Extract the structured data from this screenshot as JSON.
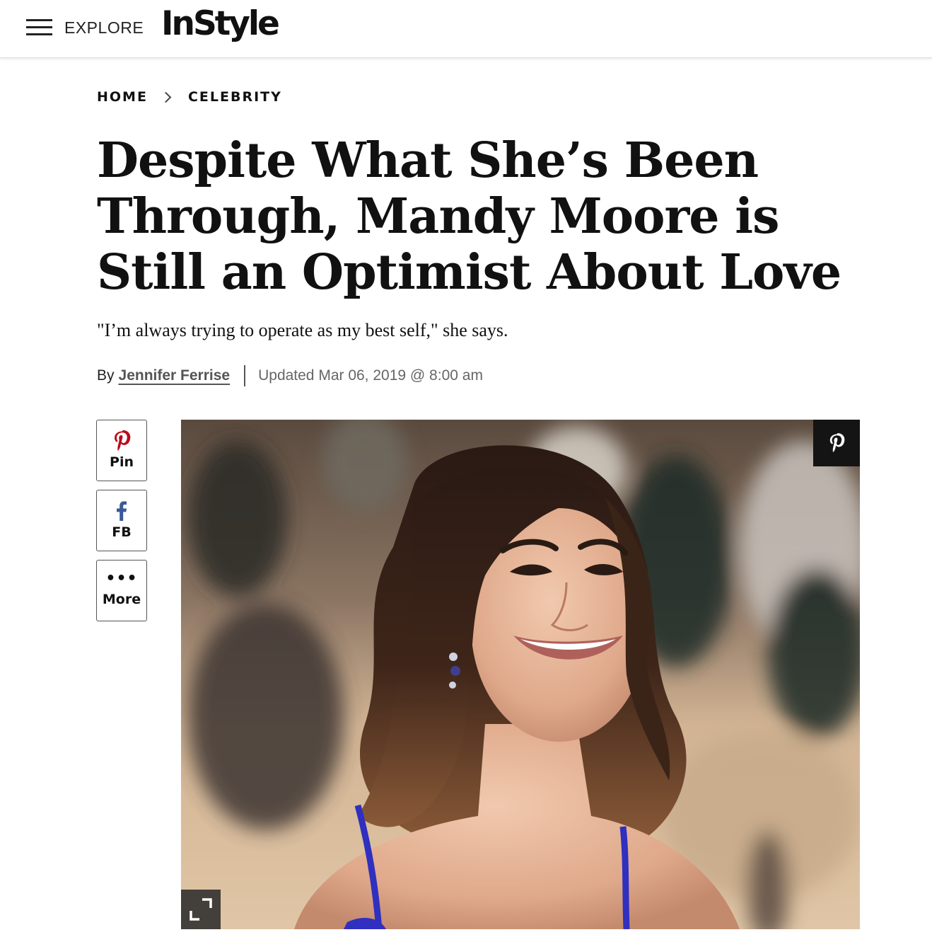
{
  "header": {
    "menu_label": "EXPLORE",
    "logo_text": "InStyle"
  },
  "breadcrumb": {
    "items": [
      "HOME",
      "CELEBRITY"
    ]
  },
  "article": {
    "headline": "Despite What She’s Been Through, Mandy Moore is Still an Optimist About Love",
    "dek": "\"I’m always trying to operate as my best self,\" she says.",
    "byline_prefix": "By",
    "author": "Jennifer Ferrise",
    "updated": "Updated Mar 06, 2019 @ 8:00 am"
  },
  "share": {
    "pin_label": "Pin",
    "fb_label": "FB",
    "more_label": "More",
    "pin_icon": "pinterest-icon",
    "fb_icon": "facebook-icon",
    "more_icon": "ellipsis-icon"
  },
  "hero_image": {
    "pin_icon": "pinterest-icon",
    "expand_icon": "expand-icon"
  },
  "colors": {
    "pinterest": "#bd081c",
    "facebook": "#3b5998",
    "text": "#111111"
  }
}
